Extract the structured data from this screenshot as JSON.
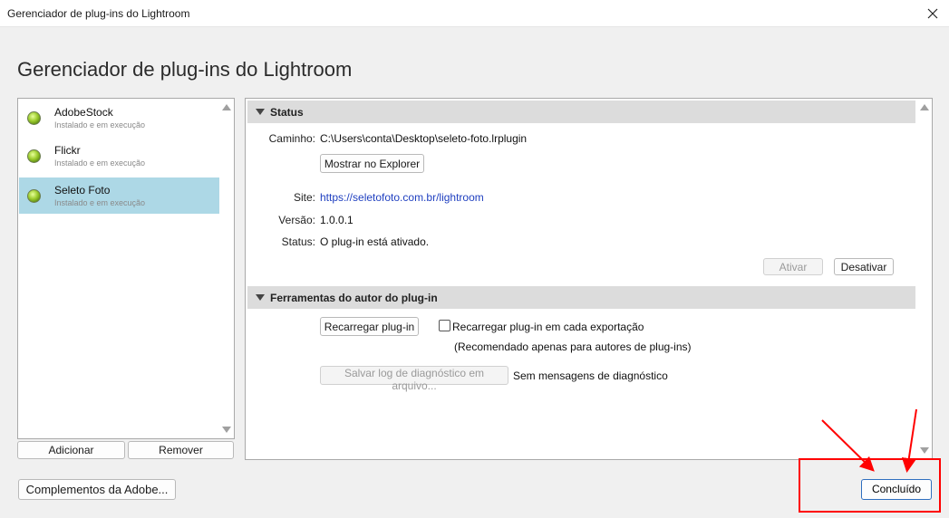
{
  "window": {
    "title": "Gerenciador de plug-ins do Lightroom"
  },
  "heading": "Gerenciador de plug-ins do Lightroom",
  "plugins": [
    {
      "name": "AdobeStock",
      "status": "Instalado e em execução",
      "selected": false
    },
    {
      "name": "Flickr",
      "status": "Instalado e em execução",
      "selected": false
    },
    {
      "name": "Seleto Foto",
      "status": "Instalado e em execução",
      "selected": true
    }
  ],
  "list_buttons": {
    "add": "Adicionar",
    "remove": "Remover"
  },
  "status_section": {
    "title": "Status",
    "path_label": "Caminho:",
    "path_value": "C:\\Users\\conta\\Desktop\\seleto-foto.lrplugin",
    "show_in_explorer": "Mostrar no Explorer",
    "site_label": "Site:",
    "site_value": "https://seletofoto.com.br/lightroom",
    "version_label": "Versão:",
    "version_value": "1.0.0.1",
    "status_label": "Status:",
    "status_value": "O plug-in está ativado.",
    "enable": "Ativar",
    "disable": "Desativar"
  },
  "tools_section": {
    "title": "Ferramentas do autor do plug-in",
    "reload": "Recarregar plug-in",
    "reload_each_export": "Recarregar plug-in em cada exportação",
    "recommended": "(Recomendado apenas para autores de plug-ins)",
    "save_log": "Salvar log de diagnóstico em arquivo...",
    "no_messages": "Sem mensagens de diagnóstico"
  },
  "footer": {
    "adobe_addons": "Complementos da Adobe...",
    "done": "Concluído"
  },
  "colors": {
    "selection": "#add8e6",
    "annotation": "#ff0000",
    "link": "#2040c0"
  }
}
